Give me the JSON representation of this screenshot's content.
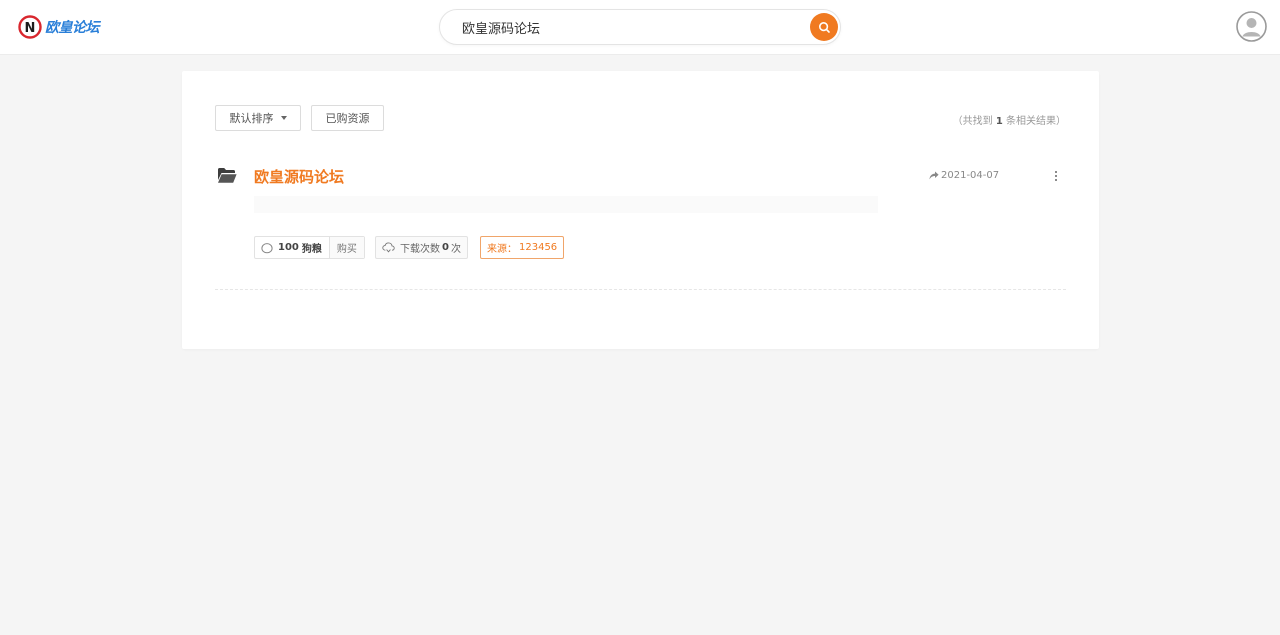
{
  "header": {
    "logo_text": "欧皇论坛",
    "logo_letter": "N",
    "search": {
      "value": "欧皇源码论坛",
      "icon": "search-icon"
    },
    "avatar_icon": "user-avatar-icon"
  },
  "toolbar": {
    "sort_label": "默认排序",
    "bought_label": "已购资源",
    "result": {
      "prefix": "（共找到",
      "count": "1",
      "suffix": "条相关结果）"
    }
  },
  "results": [
    {
      "title": "欧皇源码论坛",
      "date": "2021-04-07",
      "price": {
        "value": "100",
        "unit": "狗粮",
        "buy_label": "购买"
      },
      "downloads": {
        "prefix": "下载次数",
        "count": "0",
        "suffix": "次"
      },
      "source": {
        "label": "来源：",
        "value": "123456"
      }
    }
  ],
  "colors": {
    "accent": "#f07a21",
    "logo_blue": "#2a7fd8",
    "logo_red": "#d9272e",
    "background": "#f5f5f5"
  }
}
